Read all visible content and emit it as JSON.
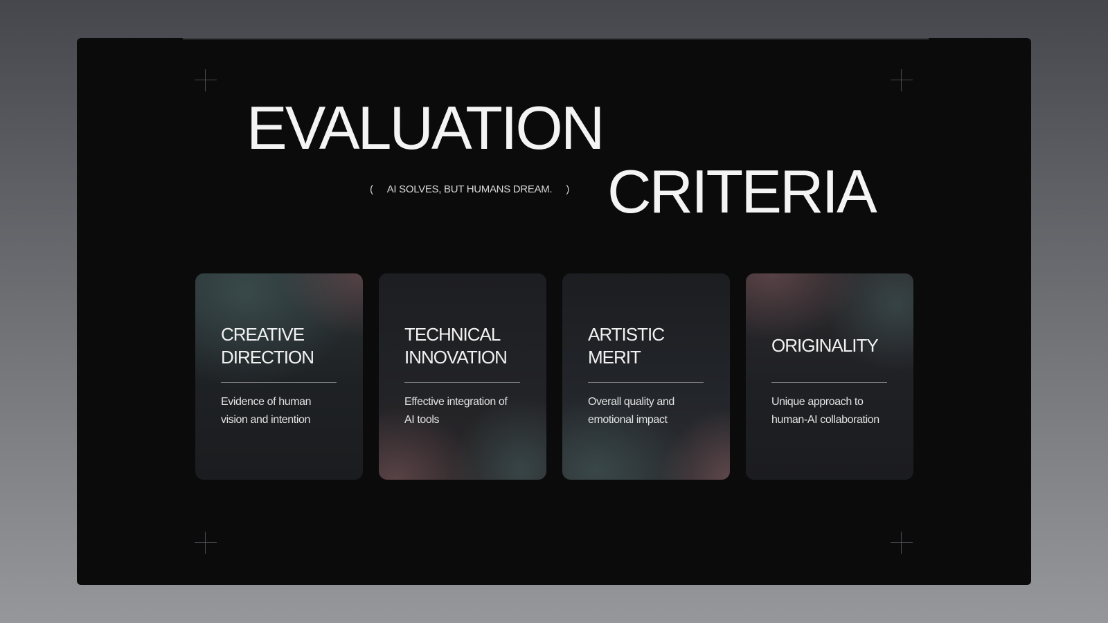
{
  "slide": {
    "title_line1": "EVALUATION",
    "title_line2": "CRITERIA",
    "tagline": {
      "open": "(",
      "text": "AI SOLVES, BUT HUMANS DREAM.",
      "close": ")"
    }
  },
  "criteria": [
    {
      "title": "CREATIVE\nDIRECTION",
      "description": "Evidence of human\nvision and intention"
    },
    {
      "title": "TECHNICAL\nINNOVATION",
      "description": "Effective integration of\nAI tools"
    },
    {
      "title": "ARTISTIC\nMERIT",
      "description": "Overall quality and\nemotional impact"
    },
    {
      "title": "ORIGINALITY",
      "description": "Unique approach to\nhuman-AI collaboration"
    }
  ],
  "colors": {
    "page_background_top": "#45474d",
    "page_background_bottom": "#96979a",
    "slide_background": "#0b0b0c",
    "title_text": "#f4f4f4",
    "card_base": "#1b1c1f",
    "accent_rose": "#7a5055",
    "accent_teal": "#465f5f"
  },
  "icons": {
    "corner_marks": "crosshair-icon"
  }
}
